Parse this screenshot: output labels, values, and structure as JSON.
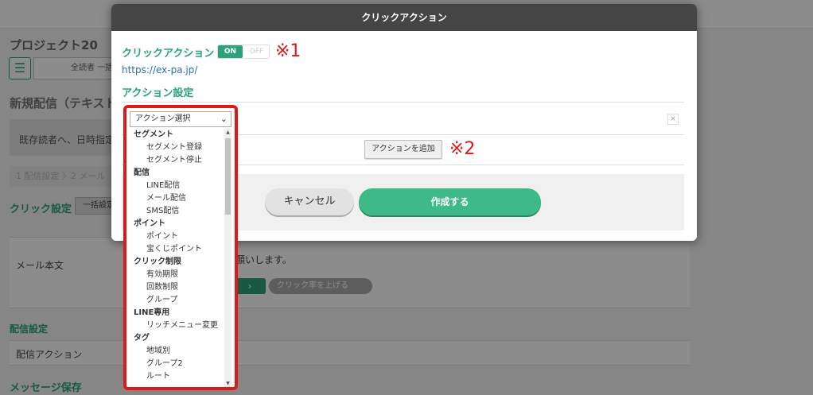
{
  "background": {
    "project_title": "プロジェクト20",
    "tab_label": "全読者 一括配",
    "section_title": "新規配信（テキスト",
    "band_text": "既存読者へ、日時指定し",
    "steps_text": "1 配信設定 〉2 メール",
    "click_settings": "クリック設定",
    "bulk_settings": "一括設定",
    "mail_body": "メール本文",
    "request_text": "願いします。",
    "click_rate_chip": "クリック率を上げる",
    "delivery_settings": "配信設定",
    "delivery_action": "配信アクション",
    "message_save": "メッセージ保存"
  },
  "modal": {
    "title": "クリックアクション",
    "click_action_label": "クリックアクション",
    "toggle_on": "ON",
    "toggle_off": "OFF",
    "annotation1": "※1",
    "url": "https://ex-pa.jp/",
    "action_settings_label": "アクション設定",
    "add_action_button": "アクションを追加",
    "annotation2": "※2",
    "cancel_button": "キャンセル",
    "create_button": "作成する",
    "remove_icon": "×"
  },
  "dropdown": {
    "selected": "アクション選択",
    "options": [
      {
        "label": "セグメント",
        "group": true
      },
      {
        "label": "セグメント登録",
        "group": false
      },
      {
        "label": "セグメント停止",
        "group": false
      },
      {
        "label": "配信",
        "group": true
      },
      {
        "label": "LINE配信",
        "group": false
      },
      {
        "label": "メール配信",
        "group": false
      },
      {
        "label": "SMS配信",
        "group": false
      },
      {
        "label": "ポイント",
        "group": true
      },
      {
        "label": "ポイント",
        "group": false
      },
      {
        "label": "宝くじポイント",
        "group": false
      },
      {
        "label": "クリック制限",
        "group": true
      },
      {
        "label": "有効期限",
        "group": false
      },
      {
        "label": "回数制限",
        "group": false
      },
      {
        "label": "グループ",
        "group": false
      },
      {
        "label": "LINE専用",
        "group": true
      },
      {
        "label": "リッチメニュー変更",
        "group": false
      },
      {
        "label": "タグ",
        "group": true
      },
      {
        "label": "地域別",
        "group": false
      },
      {
        "label": "グループ2",
        "group": false
      },
      {
        "label": "ルート",
        "group": false
      }
    ]
  },
  "colors": {
    "accent_green": "#2aa37a",
    "annotation_red": "#e01818",
    "header_dark": "#454545"
  }
}
